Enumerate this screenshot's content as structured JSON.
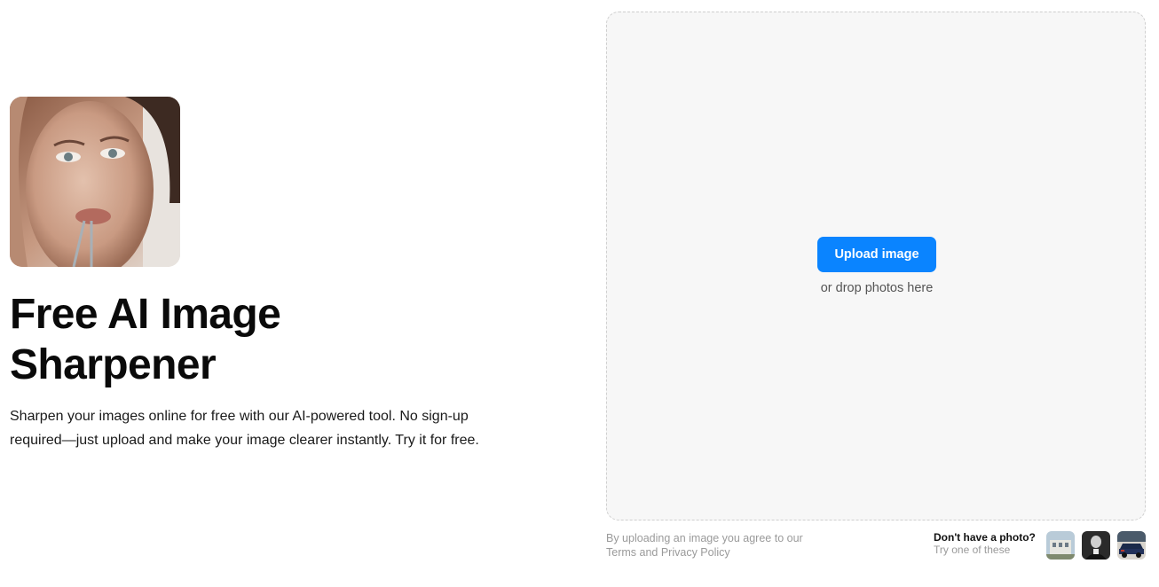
{
  "hero": {
    "image_icon": "portrait-photo",
    "title_line1": "Free AI Image",
    "title_line2": "Sharpener",
    "subtitle": "Sharpen your images online for free with our AI-powered tool. No sign-up required—just upload and make your image clearer instantly. Try it for free."
  },
  "upload": {
    "button_label": "Upload image",
    "drop_text": "or drop photos here",
    "terms_prefix": "By uploading an image you agree to our ",
    "terms_link": "Terms",
    "terms_and": " and ",
    "privacy_link": "Privacy Policy"
  },
  "samples": {
    "title": "Don't have a photo?",
    "subtitle": "Try one of these",
    "items": [
      {
        "icon": "sample-building-photo"
      },
      {
        "icon": "sample-portrait-photo"
      },
      {
        "icon": "sample-car-photo"
      }
    ]
  },
  "colors": {
    "accent": "#0a84ff",
    "dropzone_bg": "#f7f7f7",
    "muted_text": "#9a9a9a"
  }
}
